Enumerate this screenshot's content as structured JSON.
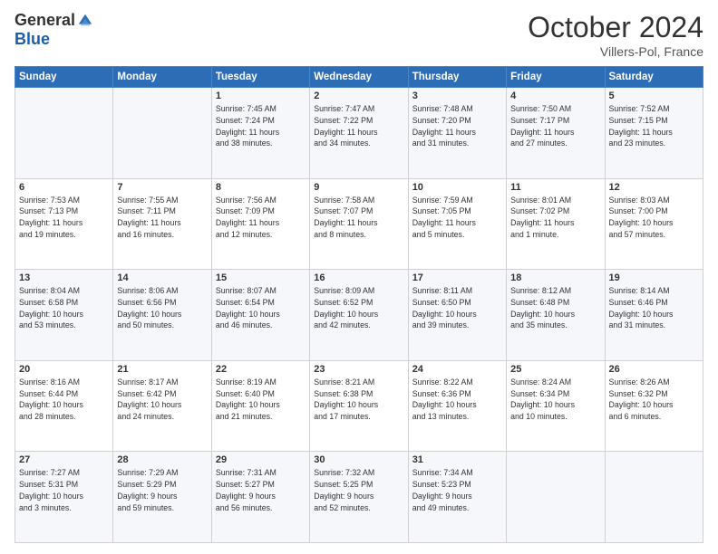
{
  "header": {
    "logo_general": "General",
    "logo_blue": "Blue",
    "month_title": "October 2024",
    "location": "Villers-Pol, France"
  },
  "weekdays": [
    "Sunday",
    "Monday",
    "Tuesday",
    "Wednesday",
    "Thursday",
    "Friday",
    "Saturday"
  ],
  "weeks": [
    [
      {
        "day": "",
        "info": ""
      },
      {
        "day": "",
        "info": ""
      },
      {
        "day": "1",
        "info": "Sunrise: 7:45 AM\nSunset: 7:24 PM\nDaylight: 11 hours\nand 38 minutes."
      },
      {
        "day": "2",
        "info": "Sunrise: 7:47 AM\nSunset: 7:22 PM\nDaylight: 11 hours\nand 34 minutes."
      },
      {
        "day": "3",
        "info": "Sunrise: 7:48 AM\nSunset: 7:20 PM\nDaylight: 11 hours\nand 31 minutes."
      },
      {
        "day": "4",
        "info": "Sunrise: 7:50 AM\nSunset: 7:17 PM\nDaylight: 11 hours\nand 27 minutes."
      },
      {
        "day": "5",
        "info": "Sunrise: 7:52 AM\nSunset: 7:15 PM\nDaylight: 11 hours\nand 23 minutes."
      }
    ],
    [
      {
        "day": "6",
        "info": "Sunrise: 7:53 AM\nSunset: 7:13 PM\nDaylight: 11 hours\nand 19 minutes."
      },
      {
        "day": "7",
        "info": "Sunrise: 7:55 AM\nSunset: 7:11 PM\nDaylight: 11 hours\nand 16 minutes."
      },
      {
        "day": "8",
        "info": "Sunrise: 7:56 AM\nSunset: 7:09 PM\nDaylight: 11 hours\nand 12 minutes."
      },
      {
        "day": "9",
        "info": "Sunrise: 7:58 AM\nSunset: 7:07 PM\nDaylight: 11 hours\nand 8 minutes."
      },
      {
        "day": "10",
        "info": "Sunrise: 7:59 AM\nSunset: 7:05 PM\nDaylight: 11 hours\nand 5 minutes."
      },
      {
        "day": "11",
        "info": "Sunrise: 8:01 AM\nSunset: 7:02 PM\nDaylight: 11 hours\nand 1 minute."
      },
      {
        "day": "12",
        "info": "Sunrise: 8:03 AM\nSunset: 7:00 PM\nDaylight: 10 hours\nand 57 minutes."
      }
    ],
    [
      {
        "day": "13",
        "info": "Sunrise: 8:04 AM\nSunset: 6:58 PM\nDaylight: 10 hours\nand 53 minutes."
      },
      {
        "day": "14",
        "info": "Sunrise: 8:06 AM\nSunset: 6:56 PM\nDaylight: 10 hours\nand 50 minutes."
      },
      {
        "day": "15",
        "info": "Sunrise: 8:07 AM\nSunset: 6:54 PM\nDaylight: 10 hours\nand 46 minutes."
      },
      {
        "day": "16",
        "info": "Sunrise: 8:09 AM\nSunset: 6:52 PM\nDaylight: 10 hours\nand 42 minutes."
      },
      {
        "day": "17",
        "info": "Sunrise: 8:11 AM\nSunset: 6:50 PM\nDaylight: 10 hours\nand 39 minutes."
      },
      {
        "day": "18",
        "info": "Sunrise: 8:12 AM\nSunset: 6:48 PM\nDaylight: 10 hours\nand 35 minutes."
      },
      {
        "day": "19",
        "info": "Sunrise: 8:14 AM\nSunset: 6:46 PM\nDaylight: 10 hours\nand 31 minutes."
      }
    ],
    [
      {
        "day": "20",
        "info": "Sunrise: 8:16 AM\nSunset: 6:44 PM\nDaylight: 10 hours\nand 28 minutes."
      },
      {
        "day": "21",
        "info": "Sunrise: 8:17 AM\nSunset: 6:42 PM\nDaylight: 10 hours\nand 24 minutes."
      },
      {
        "day": "22",
        "info": "Sunrise: 8:19 AM\nSunset: 6:40 PM\nDaylight: 10 hours\nand 21 minutes."
      },
      {
        "day": "23",
        "info": "Sunrise: 8:21 AM\nSunset: 6:38 PM\nDaylight: 10 hours\nand 17 minutes."
      },
      {
        "day": "24",
        "info": "Sunrise: 8:22 AM\nSunset: 6:36 PM\nDaylight: 10 hours\nand 13 minutes."
      },
      {
        "day": "25",
        "info": "Sunrise: 8:24 AM\nSunset: 6:34 PM\nDaylight: 10 hours\nand 10 minutes."
      },
      {
        "day": "26",
        "info": "Sunrise: 8:26 AM\nSunset: 6:32 PM\nDaylight: 10 hours\nand 6 minutes."
      }
    ],
    [
      {
        "day": "27",
        "info": "Sunrise: 7:27 AM\nSunset: 5:31 PM\nDaylight: 10 hours\nand 3 minutes."
      },
      {
        "day": "28",
        "info": "Sunrise: 7:29 AM\nSunset: 5:29 PM\nDaylight: 9 hours\nand 59 minutes."
      },
      {
        "day": "29",
        "info": "Sunrise: 7:31 AM\nSunset: 5:27 PM\nDaylight: 9 hours\nand 56 minutes."
      },
      {
        "day": "30",
        "info": "Sunrise: 7:32 AM\nSunset: 5:25 PM\nDaylight: 9 hours\nand 52 minutes."
      },
      {
        "day": "31",
        "info": "Sunrise: 7:34 AM\nSunset: 5:23 PM\nDaylight: 9 hours\nand 49 minutes."
      },
      {
        "day": "",
        "info": ""
      },
      {
        "day": "",
        "info": ""
      }
    ]
  ]
}
